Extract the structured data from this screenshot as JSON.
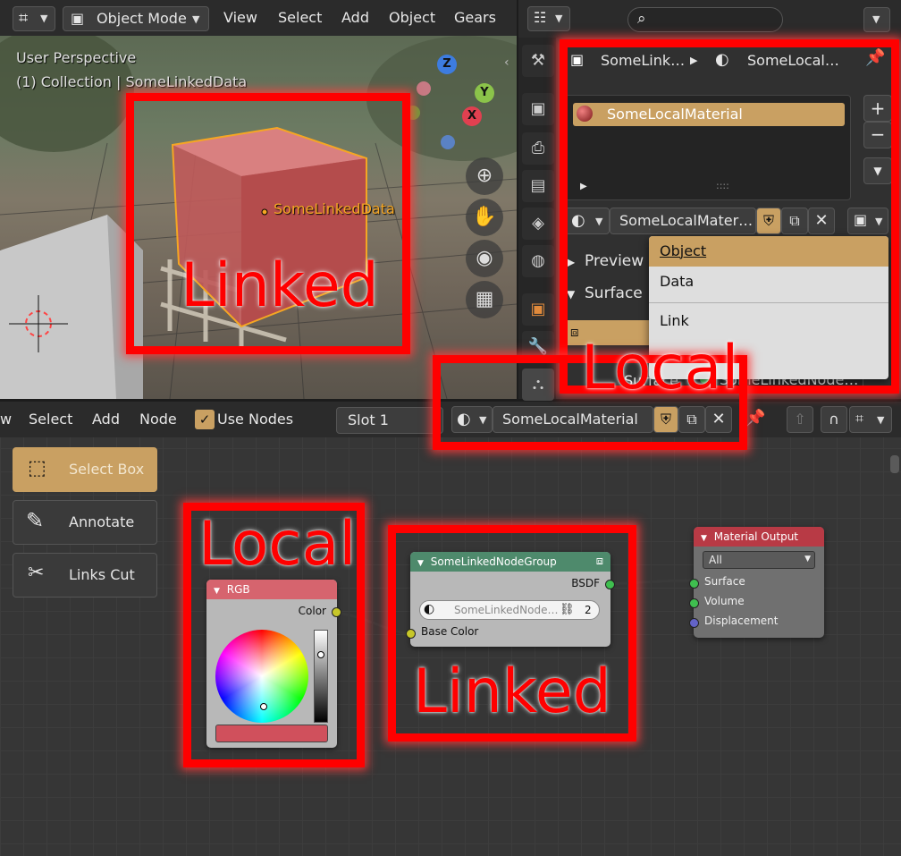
{
  "viewport": {
    "header": {
      "mode_label": "Object Mode",
      "menu": [
        "View",
        "Select",
        "Add",
        "Object",
        "Gears"
      ]
    },
    "overlay_line1": "User Perspective",
    "overlay_line2": "(1) Collection | SomeLinkedData",
    "object_label": "SomeLinkedData",
    "annotation": "Linked",
    "axes": {
      "z": "Z",
      "y": "Y",
      "x": "X"
    }
  },
  "properties": {
    "breadcrumb_object": "SomeLink…",
    "breadcrumb_material": "SomeLocal…",
    "slot_item": "SomeLocalMaterial",
    "list_grip": "::::",
    "material_field": "SomeLocalMater…",
    "dropdown": {
      "items": [
        "Object",
        "Data",
        "Link"
      ]
    },
    "panels": [
      "Preview",
      "Surface"
    ],
    "surface_label": "Surface",
    "surface_value": "SomeLinkedNode…",
    "annotation": "Local"
  },
  "node_editor": {
    "header": {
      "menu": [
        "w",
        "Select",
        "Add",
        "Node"
      ],
      "use_nodes_label": "Use Nodes",
      "slot_label": "Slot 1",
      "material_name": "SomeLocalMaterial"
    },
    "tools": [
      "Select Box",
      "Annotate",
      "Links Cut"
    ],
    "rgb_node": {
      "title": "RGB",
      "output": "Color",
      "swatch_color": "#d0505c"
    },
    "group_node": {
      "title": "SomeLinkedNodeGroup",
      "output": "BSDF",
      "datablock": "SomeLinkedNode…",
      "users": "2",
      "input": "Base Color"
    },
    "output_node": {
      "title": "Material Output",
      "target": "All",
      "inputs": [
        "Surface",
        "Volume",
        "Displacement"
      ]
    },
    "annotation_local": "Local",
    "annotation_linked": "Linked"
  },
  "colors": {
    "accent": "#c9a062",
    "annotation_red": "#ff0000",
    "group_header": "#4e8a6c",
    "output_header": "#b83a45",
    "rgb_header": "#d6646e"
  }
}
